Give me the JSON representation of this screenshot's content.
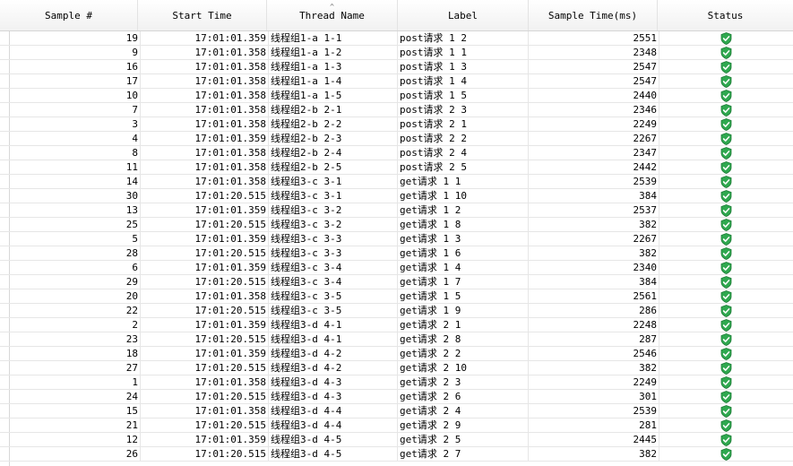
{
  "table": {
    "headers": [
      "Sample #",
      "Start Time",
      "Thread Name",
      "Label",
      "Sample Time(ms)",
      "Status"
    ],
    "sort_indicator": "^",
    "status_icon": "success-shield-icon",
    "status_color": "#2fa84f",
    "selected_row_index": 31,
    "rows": [
      {
        "sample": "19",
        "start": "17:01:01.359",
        "thread": "线程组1-a 1-1",
        "label": "post请求 1 2",
        "time": "2551"
      },
      {
        "sample": "9",
        "start": "17:01:01.358",
        "thread": "线程组1-a 1-2",
        "label": "post请求 1 1",
        "time": "2348"
      },
      {
        "sample": "16",
        "start": "17:01:01.358",
        "thread": "线程组1-a 1-3",
        "label": "post请求 1 3",
        "time": "2547"
      },
      {
        "sample": "17",
        "start": "17:01:01.358",
        "thread": "线程组1-a 1-4",
        "label": "post请求 1 4",
        "time": "2547"
      },
      {
        "sample": "10",
        "start": "17:01:01.358",
        "thread": "线程组1-a 1-5",
        "label": "post请求 1 5",
        "time": "2440"
      },
      {
        "sample": "7",
        "start": "17:01:01.358",
        "thread": "线程组2-b 2-1",
        "label": "post请求 2 3",
        "time": "2346"
      },
      {
        "sample": "3",
        "start": "17:01:01.358",
        "thread": "线程组2-b 2-2",
        "label": "post请求 2 1",
        "time": "2249"
      },
      {
        "sample": "4",
        "start": "17:01:01.359",
        "thread": "线程组2-b 2-3",
        "label": "post请求 2 2",
        "time": "2267"
      },
      {
        "sample": "8",
        "start": "17:01:01.358",
        "thread": "线程组2-b 2-4",
        "label": "post请求 2 4",
        "time": "2347"
      },
      {
        "sample": "11",
        "start": "17:01:01.358",
        "thread": "线程组2-b 2-5",
        "label": "post请求 2 5",
        "time": "2442"
      },
      {
        "sample": "14",
        "start": "17:01:01.358",
        "thread": "线程组3-c 3-1",
        "label": "get请求 1 1",
        "time": "2539"
      },
      {
        "sample": "30",
        "start": "17:01:20.515",
        "thread": "线程组3-c 3-1",
        "label": "get请求 1 10",
        "time": "384"
      },
      {
        "sample": "13",
        "start": "17:01:01.359",
        "thread": "线程组3-c 3-2",
        "label": "get请求 1 2",
        "time": "2537"
      },
      {
        "sample": "25",
        "start": "17:01:20.515",
        "thread": "线程组3-c 3-2",
        "label": "get请求 1 8",
        "time": "382"
      },
      {
        "sample": "5",
        "start": "17:01:01.359",
        "thread": "线程组3-c 3-3",
        "label": "get请求 1 3",
        "time": "2267"
      },
      {
        "sample": "28",
        "start": "17:01:20.515",
        "thread": "线程组3-c 3-3",
        "label": "get请求 1 6",
        "time": "382"
      },
      {
        "sample": "6",
        "start": "17:01:01.359",
        "thread": "线程组3-c 3-4",
        "label": "get请求 1 4",
        "time": "2340"
      },
      {
        "sample": "29",
        "start": "17:01:20.515",
        "thread": "线程组3-c 3-4",
        "label": "get请求 1 7",
        "time": "384"
      },
      {
        "sample": "20",
        "start": "17:01:01.358",
        "thread": "线程组3-c 3-5",
        "label": "get请求 1 5",
        "time": "2561"
      },
      {
        "sample": "22",
        "start": "17:01:20.515",
        "thread": "线程组3-c 3-5",
        "label": "get请求 1 9",
        "time": "286"
      },
      {
        "sample": "2",
        "start": "17:01:01.359",
        "thread": "线程组3-d 4-1",
        "label": "get请求 2 1",
        "time": "2248"
      },
      {
        "sample": "23",
        "start": "17:01:20.515",
        "thread": "线程组3-d 4-1",
        "label": "get请求 2 8",
        "time": "287"
      },
      {
        "sample": "18",
        "start": "17:01:01.359",
        "thread": "线程组3-d 4-2",
        "label": "get请求 2 2",
        "time": "2546"
      },
      {
        "sample": "27",
        "start": "17:01:20.515",
        "thread": "线程组3-d 4-2",
        "label": "get请求 2 10",
        "time": "382"
      },
      {
        "sample": "1",
        "start": "17:01:01.358",
        "thread": "线程组3-d 4-3",
        "label": "get请求 2 3",
        "time": "2249"
      },
      {
        "sample": "24",
        "start": "17:01:20.515",
        "thread": "线程组3-d 4-3",
        "label": "get请求 2 6",
        "time": "301"
      },
      {
        "sample": "15",
        "start": "17:01:01.358",
        "thread": "线程组3-d 4-4",
        "label": "get请求 2 4",
        "time": "2539"
      },
      {
        "sample": "21",
        "start": "17:01:20.515",
        "thread": "线程组3-d 4-4",
        "label": "get请求 2 9",
        "time": "281"
      },
      {
        "sample": "12",
        "start": "17:01:01.359",
        "thread": "线程组3-d 4-5",
        "label": "get请求 2 5",
        "time": "2445"
      },
      {
        "sample": "26",
        "start": "17:01:20.515",
        "thread": "线程组3-d 4-5",
        "label": "get请求 2 7",
        "time": "382"
      }
    ]
  }
}
